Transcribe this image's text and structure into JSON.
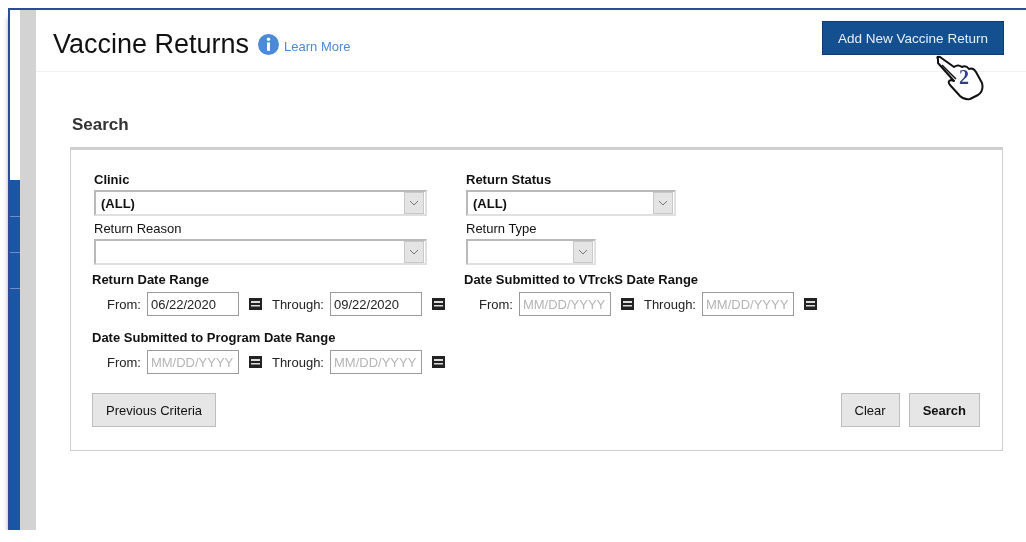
{
  "header": {
    "title": "Vaccine Returns",
    "help_link": "Learn More",
    "add_button": "Add New Vaccine Return",
    "callout_number": "2"
  },
  "search": {
    "title": "Search",
    "selects": [
      {
        "label": "Clinic",
        "bold": true,
        "value": "(ALL)",
        "kind": "wide"
      },
      {
        "label": "Return Status",
        "bold": true,
        "value": "(ALL)",
        "kind": "medium"
      },
      {
        "label": "Return Reason",
        "bold": false,
        "kind": "wide"
      },
      {
        "label": "Return Type",
        "bold": false,
        "kind": "narrow"
      }
    ],
    "date_ranges": [
      {
        "label": "Return Date Range",
        "from_label": "From:",
        "from_value": "06/22/2020",
        "through_label": "Through:",
        "through_value": "09/22/2020"
      },
      {
        "label": "Date Submitted to VTrckS Date Range",
        "from_label": "From:",
        "from_placeholder": "MM/DD/YYYY",
        "through_label": "Through:",
        "through_placeholder": "MM/DD/YYYY"
      },
      {
        "label": "Date Submitted to Program Date Range",
        "from_label": "From:",
        "from_placeholder": "MM/DD/YYYY",
        "through_label": "Through:",
        "through_placeholder": "MM/DD/YYYY"
      }
    ],
    "left_buttons": [
      {
        "label": "Previous Criteria",
        "primary": false
      }
    ],
    "right_buttons": [
      {
        "label": "Clear",
        "primary": false
      },
      {
        "label": "Search",
        "primary": true
      }
    ]
  }
}
